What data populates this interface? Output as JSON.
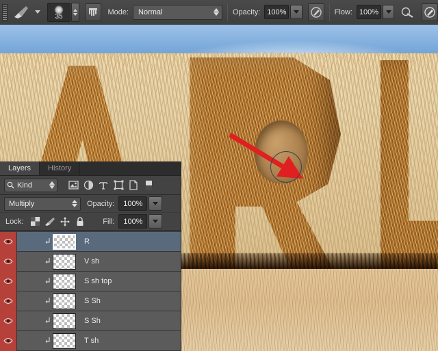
{
  "options_bar": {
    "tool_preset_icon": "brush-tool-icon",
    "brush_preset_picker_icon": "chevron-down-icon",
    "brush_size": "35",
    "brush_panel_toggle_icon": "brush-panel-icon",
    "mode_label": "Mode:",
    "mode_value": "Normal",
    "opacity_label": "Opacity:",
    "opacity_value": "100%",
    "pressure_opacity_icon": "tablet-pressure-opacity-icon",
    "flow_label": "Flow:",
    "flow_value": "100%",
    "airbrush_icon": "airbrush-icon",
    "pressure_size_icon": "tablet-pressure-size-icon"
  },
  "layers_panel": {
    "tabs": [
      {
        "label": "Layers",
        "active": true
      },
      {
        "label": "History",
        "active": false
      }
    ],
    "filter_row": {
      "search_icon": "search-icon",
      "kind_label": "Kind",
      "stepper_icon": "stepper-updown-icon",
      "icons": [
        "filter-pixel-layers-icon",
        "filter-adjustment-layers-icon",
        "filter-type-layers-icon",
        "filter-shape-layers-icon",
        "filter-smart-object-icon",
        "filter-toggle-icon"
      ]
    },
    "blend_row": {
      "blend_mode": "Multiply",
      "opacity_label": "Opacity:",
      "opacity_value": "100%"
    },
    "lock_row": {
      "lock_label": "Lock:",
      "lock_icons": [
        "lock-transparent-pixels-icon",
        "lock-image-pixels-icon",
        "lock-position-icon",
        "lock-all-icon"
      ],
      "fill_label": "Fill:",
      "fill_value": "100%"
    },
    "layers": [
      {
        "name": "R",
        "visible": true,
        "selected": true,
        "clipped": true
      },
      {
        "name": "V sh",
        "visible": true,
        "selected": false,
        "clipped": true
      },
      {
        "name": "S sh top",
        "visible": true,
        "selected": false,
        "clipped": true
      },
      {
        "name": "S Sh",
        "visible": true,
        "selected": false,
        "clipped": true
      },
      {
        "name": "S Sh",
        "visible": true,
        "selected": false,
        "clipped": true
      },
      {
        "name": "T sh",
        "visible": true,
        "selected": false,
        "clipped": true
      }
    ]
  },
  "canvas": {
    "annotation_arrow_color": "#e02020",
    "brush_cursor": "brush-cursor-circle"
  },
  "colors": {
    "panel_bg": "#3b3b3b",
    "options_bar_bg": "#454545",
    "row_bg": "#5b5b5b",
    "row_selected_bg": "#5a6a7d",
    "eye_column_bg": "#b5413a",
    "arrow_red": "#e02020"
  }
}
